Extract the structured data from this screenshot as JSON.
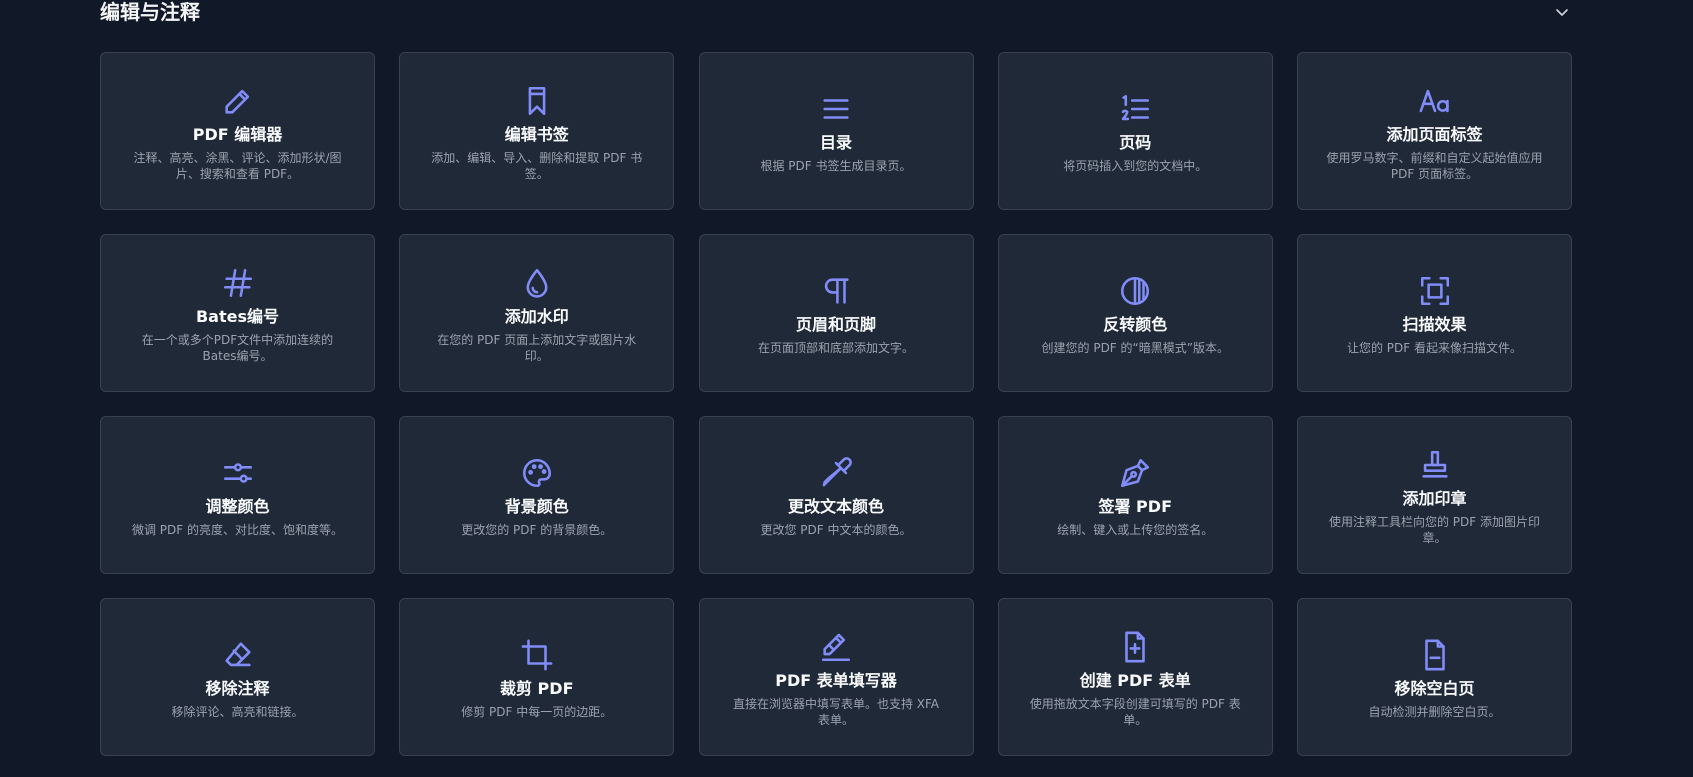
{
  "section": {
    "title": "编辑与注释"
  },
  "colors": {
    "background": "#111827",
    "card": "#1f2937",
    "card_border": "#374151",
    "accent": "#818cf8"
  },
  "tools": [
    {
      "icon": "pencil-icon",
      "title": "PDF 编辑器",
      "desc": "注释、高亮、涂黑、评论、添加形状/图片、搜索和查看 PDF。"
    },
    {
      "icon": "bookmark-icon",
      "title": "编辑书签",
      "desc": "添加、编辑、导入、删除和提取 PDF 书签。"
    },
    {
      "icon": "list-icon",
      "title": "目录",
      "desc": "根据 PDF 书签生成目录页。"
    },
    {
      "icon": "numbered-list-icon",
      "title": "页码",
      "desc": "将页码插入到您的文档中。"
    },
    {
      "icon": "text-aa-icon",
      "title": "添加页面标签",
      "desc": "使用罗马数字、前缀和自定义起始值应用 PDF 页面标签。"
    },
    {
      "icon": "hash-icon",
      "title": "Bates编号",
      "desc": "在一个或多个PDF文件中添加连续的Bates编号。"
    },
    {
      "icon": "droplet-icon",
      "title": "添加水印",
      "desc": "在您的 PDF 页面上添加文字或图片水印。"
    },
    {
      "icon": "pilcrow-icon",
      "title": "页眉和页脚",
      "desc": "在页面顶部和底部添加文字。"
    },
    {
      "icon": "contrast-icon",
      "title": "反转颜色",
      "desc": "创建您的 PDF 的“暗黑模式”版本。"
    },
    {
      "icon": "scan-icon",
      "title": "扫描效果",
      "desc": "让您的 PDF 看起来像扫描文件。"
    },
    {
      "icon": "sliders-icon",
      "title": "调整颜色",
      "desc": "微调 PDF 的亮度、对比度、饱和度等。"
    },
    {
      "icon": "palette-icon",
      "title": "背景颜色",
      "desc": "更改您的 PDF 的背景颜色。"
    },
    {
      "icon": "eyedropper-icon",
      "title": "更改文本颜色",
      "desc": "更改您 PDF 中文本的颜色。"
    },
    {
      "icon": "pen-nib-icon",
      "title": "签署 PDF",
      "desc": "绘制、键入或上传您的签名。"
    },
    {
      "icon": "stamp-icon",
      "title": "添加印章",
      "desc": "使用注释工具栏向您的 PDF 添加图片印章。"
    },
    {
      "icon": "eraser-icon",
      "title": "移除注释",
      "desc": "移除评论、高亮和链接。"
    },
    {
      "icon": "crop-icon",
      "title": "裁剪 PDF",
      "desc": "修剪 PDF 中每一页的边距。"
    },
    {
      "icon": "pencil-line-icon",
      "title": "PDF 表单填写器",
      "desc": "直接在浏览器中填写表单。也支持 XFA 表单。"
    },
    {
      "icon": "file-plus-icon",
      "title": "创建 PDF 表单",
      "desc": "使用拖放文本字段创建可填写的 PDF 表单。"
    },
    {
      "icon": "file-minus-icon",
      "title": "移除空白页",
      "desc": "自动检测并删除空白页。"
    }
  ]
}
